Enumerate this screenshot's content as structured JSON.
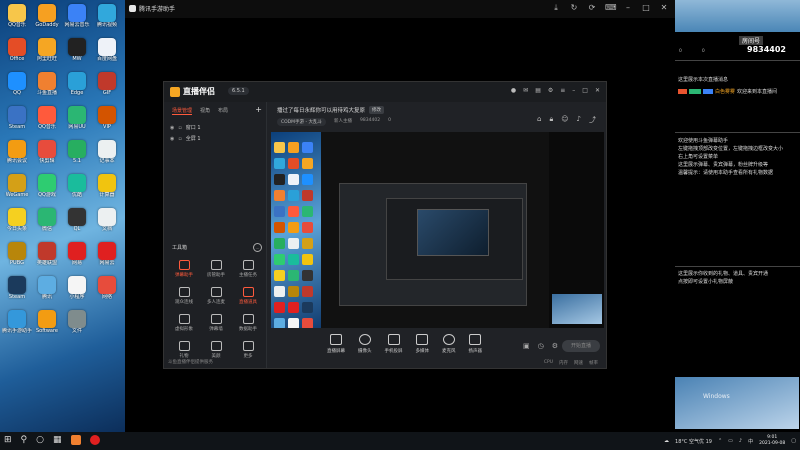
{
  "app_window": {
    "title": "腾讯手游助手",
    "titlebar_icons": [
      "download-icon",
      "refresh-icon",
      "rotate-icon",
      "keyboard-icon",
      "minimize-icon",
      "maximize-icon",
      "close-icon"
    ]
  },
  "desktop": {
    "icons": [
      {
        "label": "QQ音乐",
        "color": "#f7c64a"
      },
      {
        "label": "GoDaddy",
        "color": "#f6a021"
      },
      {
        "label": "网易云音乐",
        "color": "#3b82f6"
      },
      {
        "label": "腾讯视频",
        "color": "#31a8dc"
      },
      {
        "label": "Office",
        "color": "#e44d26"
      },
      {
        "label": "阿里旺旺",
        "color": "#f5a623"
      },
      {
        "label": "MW",
        "color": "#222222"
      },
      {
        "label": "百度网盘",
        "color": "#eef2f8"
      },
      {
        "label": "QQ",
        "color": "#1e90ff"
      },
      {
        "label": "斗鱼直播",
        "color": "#f08030"
      },
      {
        "label": "Edge",
        "color": "#2aa0d8"
      },
      {
        "label": "GIF",
        "color": "#c0392b"
      },
      {
        "label": "Steam",
        "color": "#3a72c4"
      },
      {
        "label": "QQ音乐",
        "color": "#ff5a3c"
      },
      {
        "label": "网易UU",
        "color": "#2bb673"
      },
      {
        "label": "VIP",
        "color": "#d35400"
      },
      {
        "label": "腾讯会议",
        "color": "#f39c12"
      },
      {
        "label": "快剪辑",
        "color": "#e74c3c"
      },
      {
        "label": "5.1",
        "color": "#27ae60"
      },
      {
        "label": "记事本",
        "color": "#ecf0f1"
      },
      {
        "label": "WeGame",
        "color": "#d4a017"
      },
      {
        "label": "QQ游戏",
        "color": "#2ecc71"
      },
      {
        "label": "优酷",
        "color": "#1abc9c"
      },
      {
        "label": "计算器",
        "color": "#f1c40f"
      },
      {
        "label": "今日头条",
        "color": "#f5d020"
      },
      {
        "label": "微信",
        "color": "#2bb673"
      },
      {
        "label": "QL",
        "color": "#333333"
      },
      {
        "label": "文档",
        "color": "#ecf0f1"
      },
      {
        "label": "PUBG",
        "color": "#b8860b"
      },
      {
        "label": "英雄联盟",
        "color": "#c0392b"
      },
      {
        "label": "网易",
        "color": "#e02020"
      },
      {
        "label": "网易云",
        "color": "#e02020"
      },
      {
        "label": "Steam",
        "color": "#1b3a5c"
      },
      {
        "label": "腾讯",
        "color": "#5dade2"
      },
      {
        "label": "小程序",
        "color": "#f5f5f5"
      },
      {
        "label": "网络",
        "color": "#e74c3c"
      },
      {
        "label": "腾讯手游助手",
        "color": "#3498db"
      },
      {
        "label": "Software",
        "color": "#f39c12"
      },
      {
        "label": "文件",
        "color": "#7f8c8d"
      }
    ]
  },
  "assistant": {
    "logo_text": "直播伴侣",
    "version": "6.5.1",
    "header_icons": [
      "avatar-icon",
      "message-icon",
      "mail-icon",
      "settings-icon",
      "menu-icon",
      "minimize-icon",
      "maximize-icon",
      "close-icon"
    ],
    "tabs": [
      {
        "label": "场景管理",
        "active": true
      },
      {
        "label": "视角",
        "active": false
      },
      {
        "label": "布局",
        "active": false
      }
    ],
    "scenes": [
      {
        "label": "窗口 1"
      },
      {
        "label": "全屏 1"
      }
    ],
    "toolbox_title": "工具箱",
    "tools": [
      {
        "label": "弹幕助手",
        "red": true
      },
      {
        "label": "房管助手",
        "red": false
      },
      {
        "label": "主播任务",
        "red": false
      },
      {
        "label": "观众连线",
        "red": false
      },
      {
        "label": "多人连麦",
        "red": false
      },
      {
        "label": "直播道具",
        "red": true
      },
      {
        "label": "虚拟形象",
        "red": false
      },
      {
        "label": "弹幕墙",
        "red": false
      },
      {
        "label": "数据助手",
        "red": false
      },
      {
        "label": "礼物",
        "red": false
      },
      {
        "label": "美颜",
        "red": false
      },
      {
        "label": "更多",
        "red": false
      }
    ],
    "footer_left": "斗鱼直播伴侣提供服务",
    "room_title": "播过了每日永辉你可以用待鸡大复原",
    "room_title_tag": "修改",
    "room_category": "CODM手游 - 大乱斗",
    "room_meta": [
      "新人主播",
      "9834402",
      "0"
    ],
    "controls": [
      {
        "label": "直播屏幕"
      },
      {
        "label": "摄像头"
      },
      {
        "label": "手机投屏"
      },
      {
        "label": "多媒体"
      },
      {
        "label": "麦克风"
      },
      {
        "label": "扬声器"
      }
    ],
    "start_button": "开始直播",
    "footer_right": [
      "CPU",
      "内存",
      "网速",
      "帧率"
    ]
  },
  "right_panel": {
    "room_label": "房间号",
    "room_id": "9834402",
    "stats": [
      "0",
      "0"
    ],
    "notice_1": "这里展示本次直播消息",
    "welcome_name": "白色雾雾",
    "welcome_msg": "欢迎来到本直播间",
    "notice_2": "欢迎使用斗鱼弹幕助手\n左键拖拽顶部改变位置，左键拖拽边框改变大小\n右上角可设置菜单\n这里展示弹幕、贵宾弹幕，粉丝牌升级等\n温馨提示：请使用本助手查看所有礼物数据",
    "notice_3": "这里展示你收到的礼物、道具、贵宾开通\n点按即可设置小礼物屏蔽"
  },
  "taskbar": {
    "weather": "18°C 空气优 19",
    "ime": "中",
    "time": "9:01",
    "date": "2021-09-08"
  }
}
